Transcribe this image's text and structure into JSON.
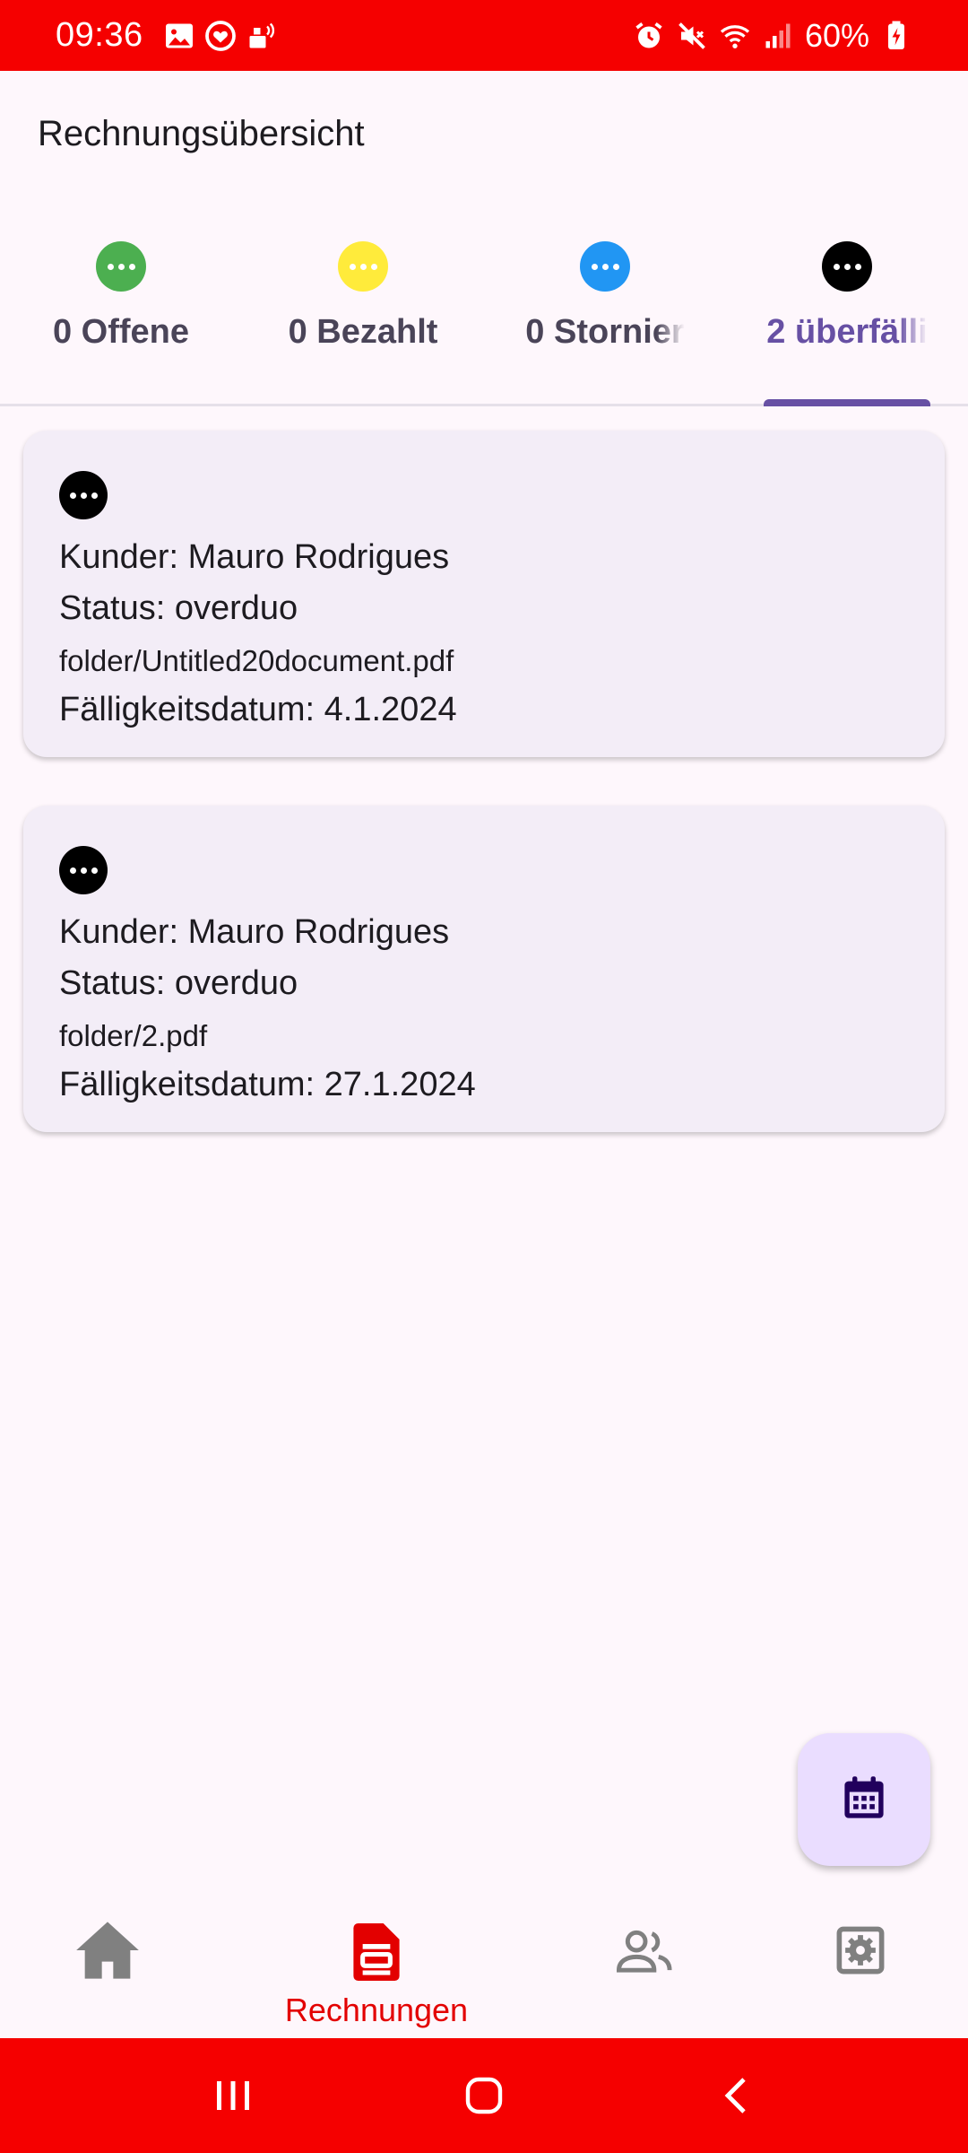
{
  "status_bar": {
    "time": "09:36",
    "battery": "60%",
    "left_icons": [
      "image-icon",
      "heart-monitor-icon",
      "savings-icon"
    ],
    "right_icons": [
      "alarm-icon",
      "mute-icon",
      "wifi-icon",
      "signal-icon",
      "battery-icon"
    ],
    "color": "#f50000"
  },
  "header": {
    "title": "Rechnungsübersicht"
  },
  "tabs": [
    {
      "label": "0 Offene",
      "dot_color": "#4caf50",
      "active": false
    },
    {
      "label": "0 Bezahlt",
      "dot_color": "#ffeb3b",
      "active": false
    },
    {
      "label": "0 Stornier",
      "dot_color": "#2196f3",
      "active": false
    },
    {
      "label": "2 überfälli",
      "dot_color": "#000000",
      "active": true
    }
  ],
  "invoices": [
    {
      "customer": "Kunder: Mauro Rodrigues",
      "status": "Status: overduo",
      "file": "folder/Untitled20document.pdf",
      "due_date": "Fälligkeitsdatum: 4.1.2024",
      "icon": "more-dots-icon"
    },
    {
      "customer": "Kunder: Mauro Rodrigues",
      "status": "Status: overduo",
      "file": "folder/2.pdf",
      "due_date": "Fälligkeitsdatum: 27.1.2024",
      "icon": "more-dots-icon"
    }
  ],
  "fab": {
    "icon": "calendar-icon",
    "background": "#eaddff"
  },
  "bottom_nav": {
    "items": [
      {
        "icon": "home-icon",
        "label": "",
        "active": false
      },
      {
        "icon": "invoice-icon",
        "label": "Rechnungen",
        "active": true
      },
      {
        "icon": "people-icon",
        "label": "",
        "active": false
      },
      {
        "icon": "settings-icon",
        "label": "",
        "active": false
      }
    ],
    "active_color": "#e30000",
    "inactive_color": "#808080"
  },
  "system_nav": {
    "buttons": [
      "recent-apps-icon",
      "home-circle-icon",
      "back-icon"
    ]
  }
}
